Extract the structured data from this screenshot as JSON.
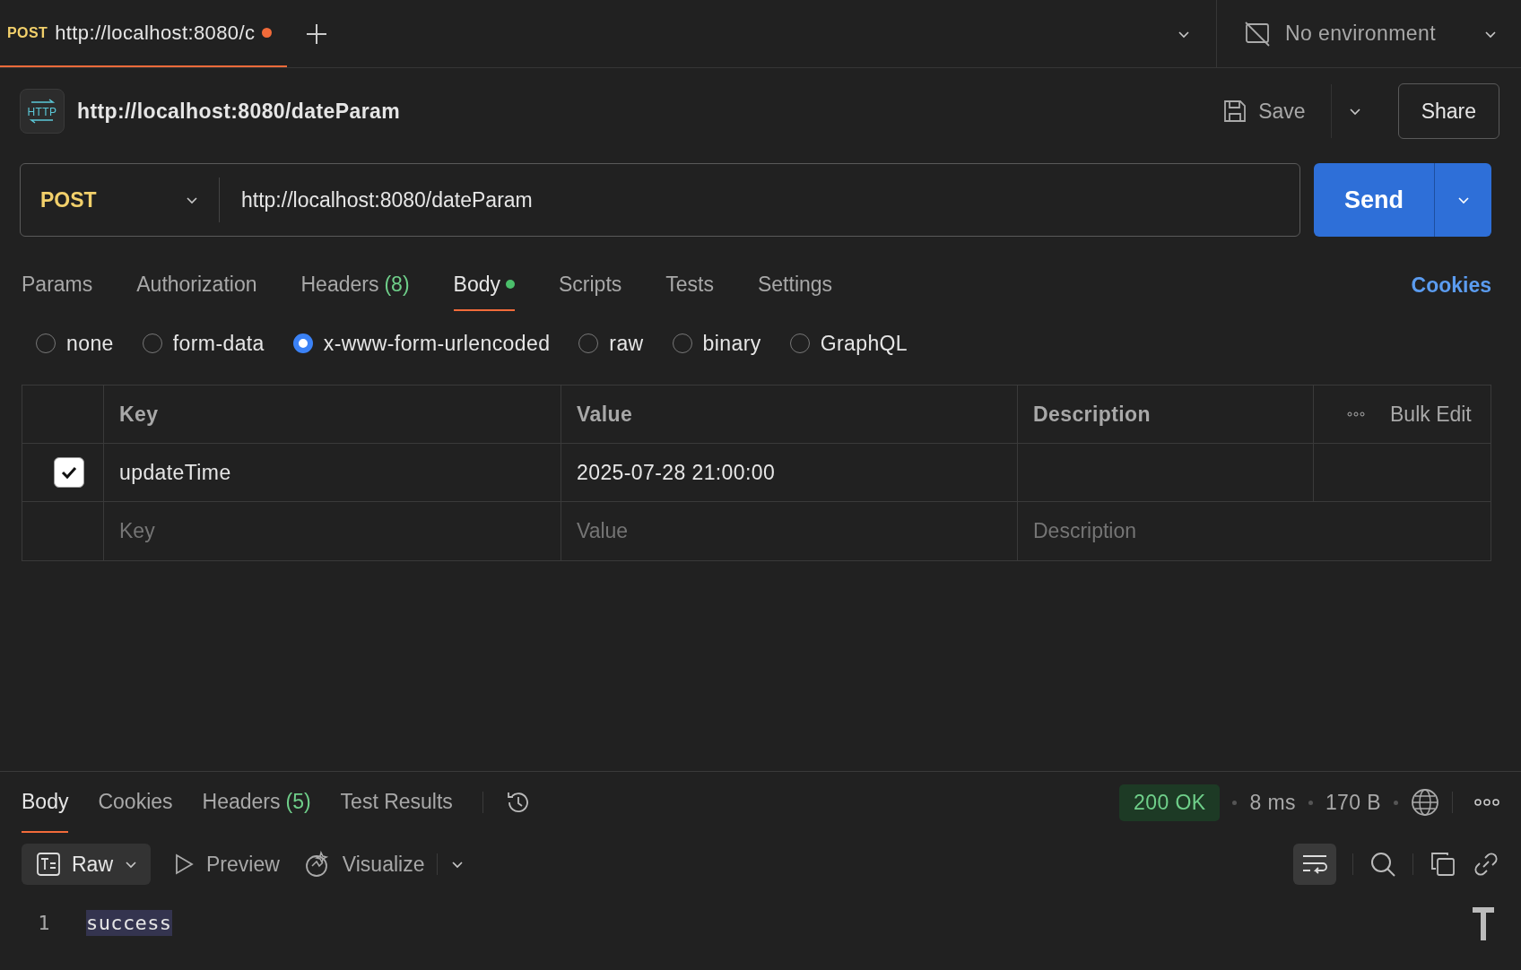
{
  "tabs": [
    {
      "method": "POST",
      "title": "http://localhost:8080/c",
      "unsaved": true,
      "selected": true
    }
  ],
  "environment": {
    "label": "No environment"
  },
  "request": {
    "icon_text": "HTTP",
    "title": "http://localhost:8080/dateParam",
    "save": "Save",
    "share": "Share"
  },
  "url_bar": {
    "method": "POST",
    "url": "http://localhost:8080/dateParam",
    "send": "Send"
  },
  "request_tabs": [
    {
      "label": "Params",
      "selected": false
    },
    {
      "label": "Authorization",
      "selected": false
    },
    {
      "label": "Headers",
      "count": "(8)",
      "selected": false
    },
    {
      "label": "Body",
      "selected": true,
      "modified": true
    },
    {
      "label": "Scripts",
      "selected": false
    },
    {
      "label": "Tests",
      "selected": false
    },
    {
      "label": "Settings",
      "selected": false
    }
  ],
  "cookies_link": "Cookies",
  "body_types": [
    {
      "label": "none",
      "selected": false
    },
    {
      "label": "form-data",
      "selected": false
    },
    {
      "label": "x-www-form-urlencoded",
      "selected": true
    },
    {
      "label": "raw",
      "selected": false
    },
    {
      "label": "binary",
      "selected": false
    },
    {
      "label": "GraphQL",
      "selected": false
    }
  ],
  "table": {
    "columns": [
      "Key",
      "Value",
      "Description"
    ],
    "bulk_edit": "Bulk Edit",
    "rows": [
      {
        "checked": true,
        "key": "updateTime",
        "value": "2025-07-28 21:00:00"
      }
    ],
    "new_row": {
      "key": {
        "placeholder": "Key"
      },
      "value": {
        "placeholder": "Value"
      },
      "description": {
        "placeholder": "Description"
      }
    }
  },
  "response": {
    "tabs": [
      {
        "label": "Body",
        "selected": true
      },
      {
        "label": "Cookies",
        "selected": false
      },
      {
        "label": "Headers",
        "count": "(5)",
        "selected": false
      },
      {
        "label": "Test Results",
        "selected": false
      }
    ],
    "status": "200 OK",
    "time": "8 ms",
    "size": "170 B",
    "format": "Raw",
    "preview": "Preview",
    "visualize": "Visualize",
    "lines": [
      {
        "number": "1",
        "text": "success"
      }
    ]
  }
}
